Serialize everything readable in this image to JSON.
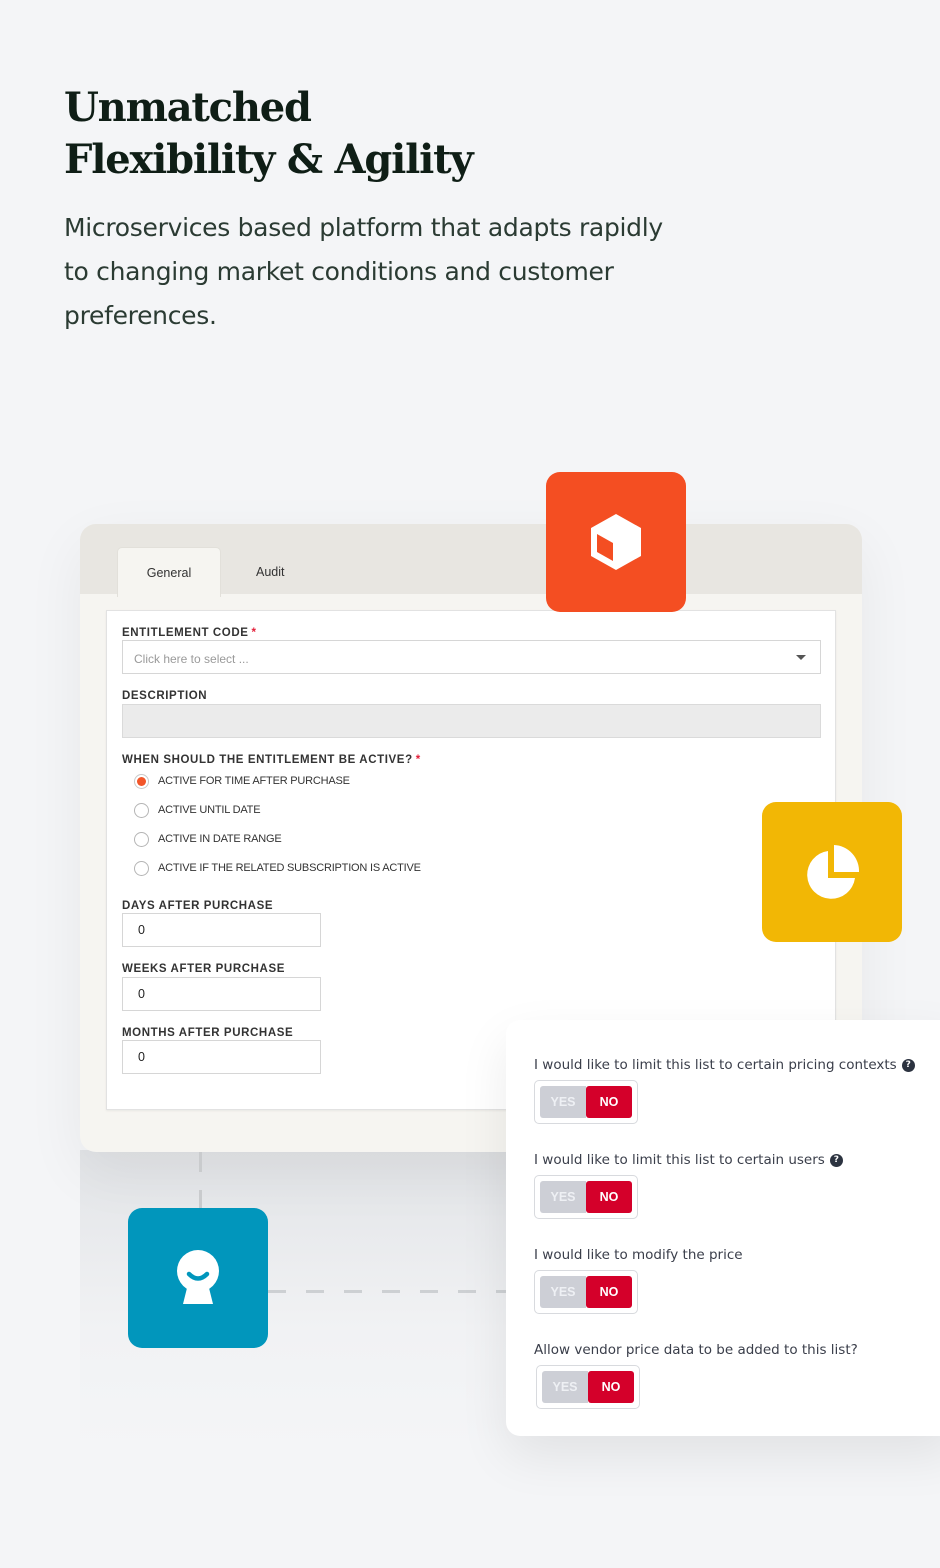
{
  "hero": {
    "title_line1": "Unmatched",
    "title_line2": "Flexibility & Agility",
    "subtitle": "Microservices based platform that adapts rapidly to changing market conditions and customer preferences."
  },
  "tiles": [
    {
      "icon": "cube-icon",
      "color": "#f44e22"
    },
    {
      "icon": "pie-chart-icon",
      "color": "#f2b705"
    },
    {
      "icon": "user-avatar-icon",
      "color": "#0196bc"
    }
  ],
  "panel": {
    "tabs": [
      {
        "label": "General",
        "active": true
      },
      {
        "label": "Audit",
        "active": false
      }
    ],
    "form": {
      "entitlement_code": {
        "label": "ENTITLEMENT CODE",
        "required_mark": "*",
        "placeholder": "Click here to select ..."
      },
      "description": {
        "label": "DESCRIPTION",
        "value": ""
      },
      "active_question": {
        "label": "WHEN SHOULD THE ENTITLEMENT BE ACTIVE?",
        "required_mark": "*",
        "options": [
          {
            "label": "ACTIVE FOR TIME AFTER PURCHASE",
            "checked": true
          },
          {
            "label": "ACTIVE UNTIL DATE",
            "checked": false
          },
          {
            "label": "ACTIVE IN DATE RANGE",
            "checked": false
          },
          {
            "label": "ACTIVE IF THE RELATED SUBSCRIPTION IS ACTIVE",
            "checked": false
          }
        ]
      },
      "days": {
        "label": "DAYS AFTER PURCHASE",
        "value": "0"
      },
      "weeks": {
        "label": "WEEKS AFTER PURCHASE",
        "value": "0"
      },
      "months": {
        "label": "MONTHS AFTER PURCHASE",
        "value": "0"
      }
    }
  },
  "settings": {
    "yes_label": "YES",
    "no_label": "NO",
    "items": [
      {
        "question": "I would like to limit this list to certain pricing contexts",
        "help": true,
        "value": "NO"
      },
      {
        "question": "I would like to limit this list to certain users",
        "help": true,
        "value": "NO"
      },
      {
        "question": "I would like to modify the price",
        "help": false,
        "value": "NO"
      },
      {
        "question": "Allow vendor price data to be added to this list?",
        "help": false,
        "value": "NO"
      }
    ],
    "help_glyph": "?",
    "accent_no": "#d4002a",
    "accent_radio": "#f2562a"
  }
}
